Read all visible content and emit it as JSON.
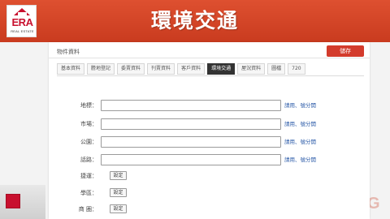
{
  "slide": {
    "title": "環境交通",
    "logo": {
      "text": "ERA",
      "subtext": "REAL ESTATE"
    },
    "right_deco": "G"
  },
  "panel": {
    "section_title": "物件資料",
    "save_label": "儲存",
    "tabs": [
      {
        "label": "基本資料",
        "active": false
      },
      {
        "label": "謄地登記",
        "active": false
      },
      {
        "label": "委賣資料",
        "active": false
      },
      {
        "label": "刊賣資料",
        "active": false
      },
      {
        "label": "客戶資料",
        "active": false
      },
      {
        "label": "環境交通",
        "active": true
      },
      {
        "label": "屋況資料",
        "active": false
      },
      {
        "label": "圖檔",
        "active": false
      },
      {
        "label": "720",
        "active": false
      }
    ],
    "text_rows": [
      {
        "label": "地標：",
        "value": "",
        "hint": "請用、號分開"
      },
      {
        "label": "市場：",
        "value": "",
        "hint": "請用、號分開"
      },
      {
        "label": "公園：",
        "value": "",
        "hint": "請用、號分開"
      },
      {
        "label": "話路：",
        "value": "",
        "hint": "請用、號分開"
      }
    ],
    "button_rows": [
      {
        "label": "捷運：",
        "button_label": "設定"
      },
      {
        "label": "學區：",
        "button_label": "設定"
      },
      {
        "label": "商 圈：",
        "button_label": "設定"
      }
    ]
  },
  "colors": {
    "header": "#d44427",
    "brand_red": "#c8102e",
    "save_button": "#d33b2c",
    "active_tab": "#333333",
    "hint_link": "#2a5aa8"
  }
}
